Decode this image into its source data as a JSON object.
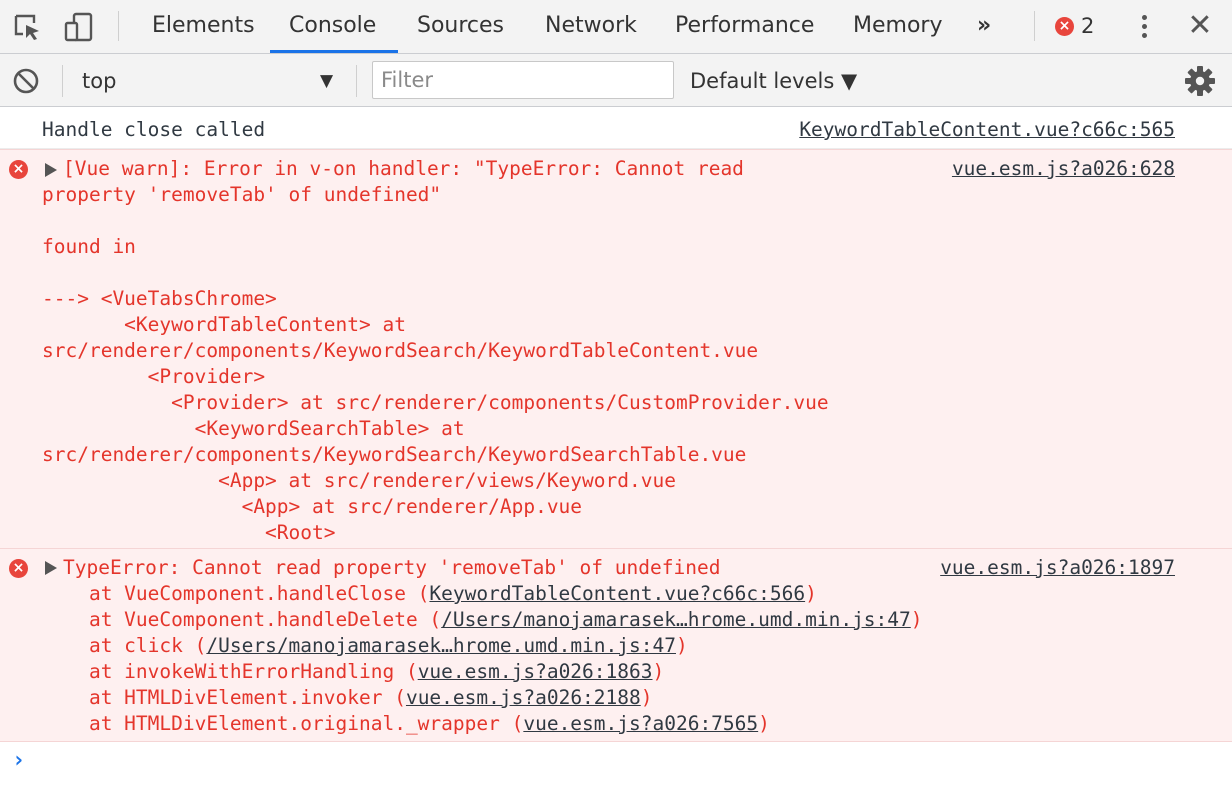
{
  "tabbar": {
    "tabs": [
      "Elements",
      "Console",
      "Sources",
      "Network",
      "Performance",
      "Memory"
    ],
    "active_tab": "Console",
    "overflow_label": "»",
    "error_count": "2",
    "icons": [
      "inspect-element-icon",
      "device-toolbar-icon",
      "more-tabs-icon",
      "error-icon",
      "kebab-menu-icon",
      "close-icon"
    ]
  },
  "toolbar": {
    "context_value": "top",
    "filter_placeholder": "Filter",
    "levels_label": "Default levels ▼"
  },
  "messages": {
    "log1": {
      "text": "Handle close called",
      "source": "KeywordTableContent.vue?c66c:565"
    },
    "error1": {
      "source": "vue.esm.js?a026:628",
      "lines": [
        "[Vue warn]: Error in v-on handler: \"TypeError: Cannot read",
        "property 'removeTab' of undefined\"",
        "",
        "found in",
        "",
        "---> <VueTabsChrome>",
        "       <KeywordTableContent> at",
        "src/renderer/components/KeywordSearch/KeywordTableContent.vue",
        "         <Provider>",
        "           <Provider> at src/renderer/components/CustomProvider.vue",
        "             <KeywordSearchTable> at",
        "src/renderer/components/KeywordSearch/KeywordSearchTable.vue",
        "               <App> at src/renderer/views/Keyword.vue",
        "                 <App> at src/renderer/App.vue",
        "                   <Root>"
      ]
    },
    "error2": {
      "source": "vue.esm.js?a026:1897",
      "headline": "TypeError: Cannot read property 'removeTab' of undefined",
      "stack": [
        {
          "prefix": "    at VueComponent.handleClose (",
          "link": "KeywordTableContent.vue?c66c:566",
          "suffix": ")"
        },
        {
          "prefix": "    at VueComponent.handleDelete (",
          "link": "/Users/manojamarasek…hrome.umd.min.js:47",
          "suffix": ")"
        },
        {
          "prefix": "    at click (",
          "link": "/Users/manojamarasek…hrome.umd.min.js:47",
          "suffix": ")"
        },
        {
          "prefix": "    at invokeWithErrorHandling (",
          "link": "vue.esm.js?a026:1863",
          "suffix": ")"
        },
        {
          "prefix": "    at HTMLDivElement.invoker (",
          "link": "vue.esm.js?a026:2188",
          "suffix": ")"
        },
        {
          "prefix": "    at HTMLDivElement.original._wrapper (",
          "link": "vue.esm.js?a026:7565",
          "suffix": ")"
        }
      ]
    }
  },
  "prompt_symbol": "›",
  "colors": {
    "error_text": "#e4352b",
    "error_bg": "#fef0f0",
    "accent": "#1a73e8",
    "toolbar_bg": "#f3f3f3"
  }
}
